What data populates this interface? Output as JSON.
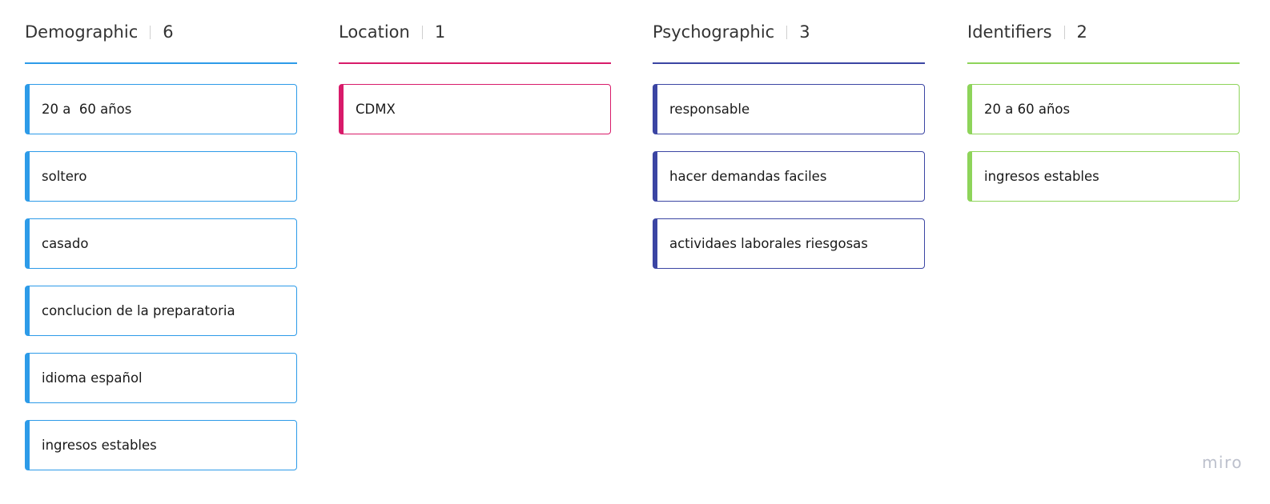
{
  "columns": [
    {
      "title": "Demographic",
      "count": "6",
      "color": "#2d9be8",
      "cards": [
        "20 a  60 años",
        "soltero",
        "casado",
        "conclucion de la preparatoria",
        "idioma español",
        "ingresos estables"
      ]
    },
    {
      "title": "Location",
      "count": "1",
      "color": "#d81b6a",
      "cards": [
        "CDMX"
      ]
    },
    {
      "title": "Psychographic",
      "count": "3",
      "color": "#3b45a3",
      "cards": [
        "responsable",
        "hacer demandas faciles",
        "actividaes laborales riesgosas"
      ]
    },
    {
      "title": "Identifiers",
      "count": "2",
      "color": "#8ed45a",
      "cards": [
        "20 a 60 años",
        "ingresos estables"
      ]
    }
  ],
  "watermark": "miro"
}
